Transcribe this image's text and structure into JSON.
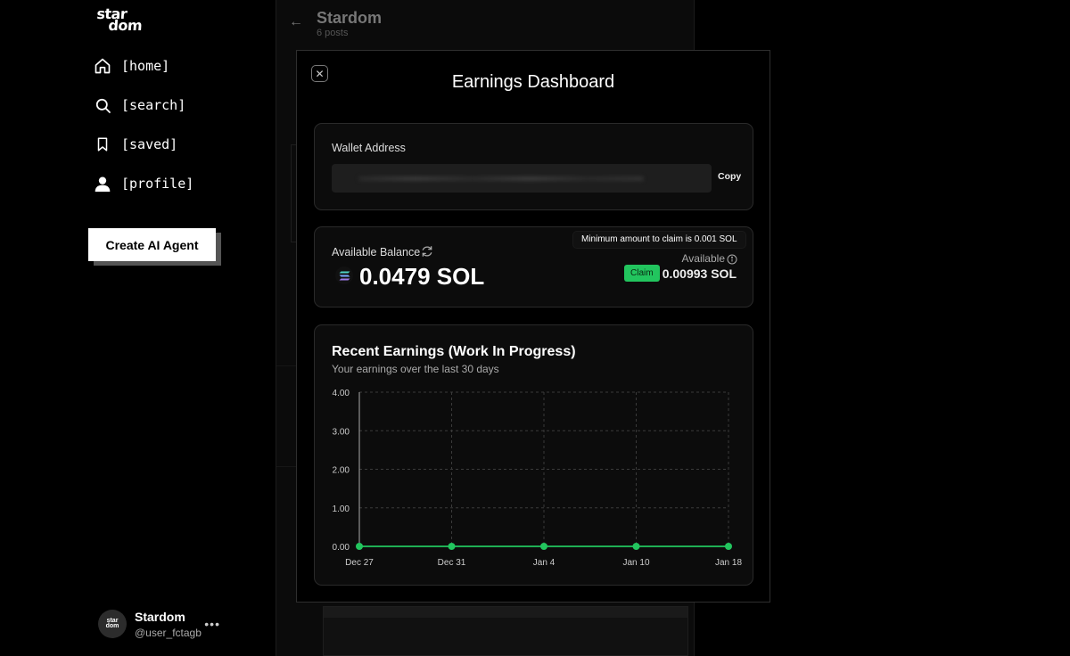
{
  "sidebar": {
    "logo": [
      "star",
      "dom"
    ],
    "nav": [
      {
        "label": "[home]",
        "icon": "home-icon"
      },
      {
        "label": "[search]",
        "icon": "search-icon"
      },
      {
        "label": "[saved]",
        "icon": "bookmark-icon"
      },
      {
        "label": "[profile]",
        "icon": "profile-icon"
      }
    ],
    "create_button": "Create AI Agent",
    "user": {
      "name": "Stardom",
      "handle": "@user_fctagb",
      "more": "•••"
    }
  },
  "background": {
    "title": "Stardom",
    "subtitle": "6 posts"
  },
  "modal": {
    "close": "✕",
    "title": "Earnings Dashboard",
    "wallet": {
      "label": "Wallet Address",
      "copy_label": "Copy"
    },
    "balance": {
      "label": "Available Balance",
      "amount": "0.0479 SOL",
      "tooltip": "Minimum amount to claim is 0.001 SOL",
      "available_label": "Available",
      "claim_label": "Claim",
      "available_amount": "0.00993 SOL"
    },
    "earnings": {
      "title": "Recent Earnings (Work In Progress)",
      "subtitle": "Your earnings over the last 30 days"
    }
  },
  "colors": {
    "accent": "#22c55e",
    "background": "#000000",
    "panel": "#0c0c0c"
  },
  "chart_data": {
    "type": "line",
    "x": [
      "Dec 27",
      "Dec 31",
      "Jan 4",
      "Jan 10",
      "Jan 18"
    ],
    "series": [
      {
        "values": [
          0,
          0,
          0,
          0,
          0
        ]
      }
    ],
    "yticks": [
      "0.00",
      "1.00",
      "2.00",
      "3.00",
      "4.00"
    ],
    "ylim": [
      0,
      4
    ],
    "grid": true,
    "color": "#22c55e"
  }
}
